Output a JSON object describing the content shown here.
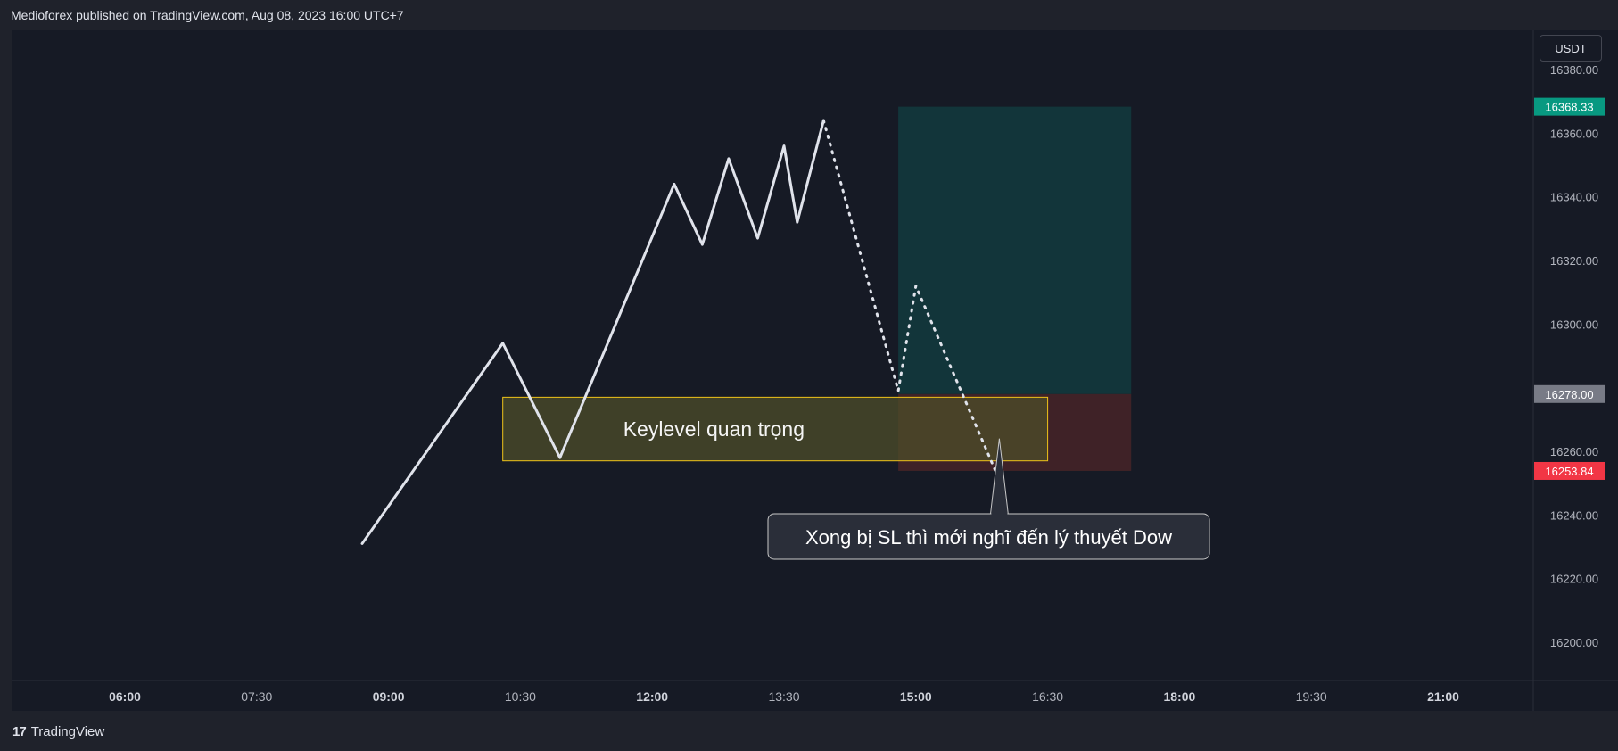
{
  "header": {
    "attribution": "Medioforex published on TradingView.com, Aug 08, 2023 16:00 UTC+7"
  },
  "footer": {
    "logo_mark": "17",
    "logo_text": "TradingView"
  },
  "price_scale": {
    "currency": "USDT",
    "ticks": [
      "16380.00",
      "16360.00",
      "16340.00",
      "16320.00",
      "16300.00",
      "16260.00",
      "16240.00",
      "16220.00",
      "16200.00"
    ],
    "badges": {
      "target": {
        "label": "16368.33",
        "value": 16368.33,
        "color": "#089981"
      },
      "entry": {
        "label": "16278.00",
        "value": 16278.0,
        "color": "#787b86"
      },
      "stop": {
        "label": "16253.84",
        "value": 16253.84,
        "color": "#f23645"
      }
    }
  },
  "time_scale": {
    "labels": [
      {
        "text": "06:00",
        "bold": true,
        "t": 6.0
      },
      {
        "text": "07:30",
        "bold": false,
        "t": 7.5
      },
      {
        "text": "09:00",
        "bold": true,
        "t": 9.0
      },
      {
        "text": "10:30",
        "bold": false,
        "t": 10.5
      },
      {
        "text": "12:00",
        "bold": true,
        "t": 12.0
      },
      {
        "text": "13:30",
        "bold": false,
        "t": 13.5
      },
      {
        "text": "15:00",
        "bold": true,
        "t": 15.0
      },
      {
        "text": "16:30",
        "bold": false,
        "t": 16.5
      },
      {
        "text": "18:00",
        "bold": true,
        "t": 18.0
      },
      {
        "text": "19:30",
        "bold": false,
        "t": 19.5
      },
      {
        "text": "21:00",
        "bold": true,
        "t": 21.0
      }
    ]
  },
  "annotations": {
    "keylevel_label": "Keylevel quan trọng",
    "callout_text": "Xong bị SL thì mới nghĩ đến lý thuyết Dow"
  },
  "colors": {
    "background": "#161a25",
    "line": "#e0e3eb",
    "keylevel_fill": "#4d4d2a",
    "keylevel_border": "#f0c419",
    "profit_zone": "#12353a",
    "loss_zone": "#3f2227"
  },
  "chart_data": {
    "type": "line",
    "ylim": [
      16189,
      16390
    ],
    "xlim": [
      5.0,
      22.45
    ],
    "series": [
      {
        "style": "solid",
        "x": [
          8.7,
          10.3,
          10.95,
          12.25,
          12.57,
          12.87,
          13.2,
          13.5,
          13.65,
          13.95
        ],
        "y": [
          16231,
          16294,
          16258,
          16344,
          16325,
          16352,
          16327,
          16356,
          16332,
          16364
        ]
      },
      {
        "style": "dotted",
        "x": [
          13.95,
          14.8,
          15.0,
          15.95
        ],
        "y": [
          16364,
          16279,
          16312,
          16251
        ]
      }
    ],
    "zones": [
      {
        "name": "keylevel",
        "x": [
          10.3,
          16.5
        ],
        "y": [
          16257,
          16277
        ]
      },
      {
        "name": "profit",
        "x": [
          14.8,
          17.45
        ],
        "y": [
          16278.0,
          16368.33
        ]
      },
      {
        "name": "loss",
        "x": [
          14.8,
          17.45
        ],
        "y": [
          16253.84,
          16278.0
        ]
      }
    ],
    "callout_anchor": {
      "x": 15.95,
      "y": 16264
    }
  }
}
